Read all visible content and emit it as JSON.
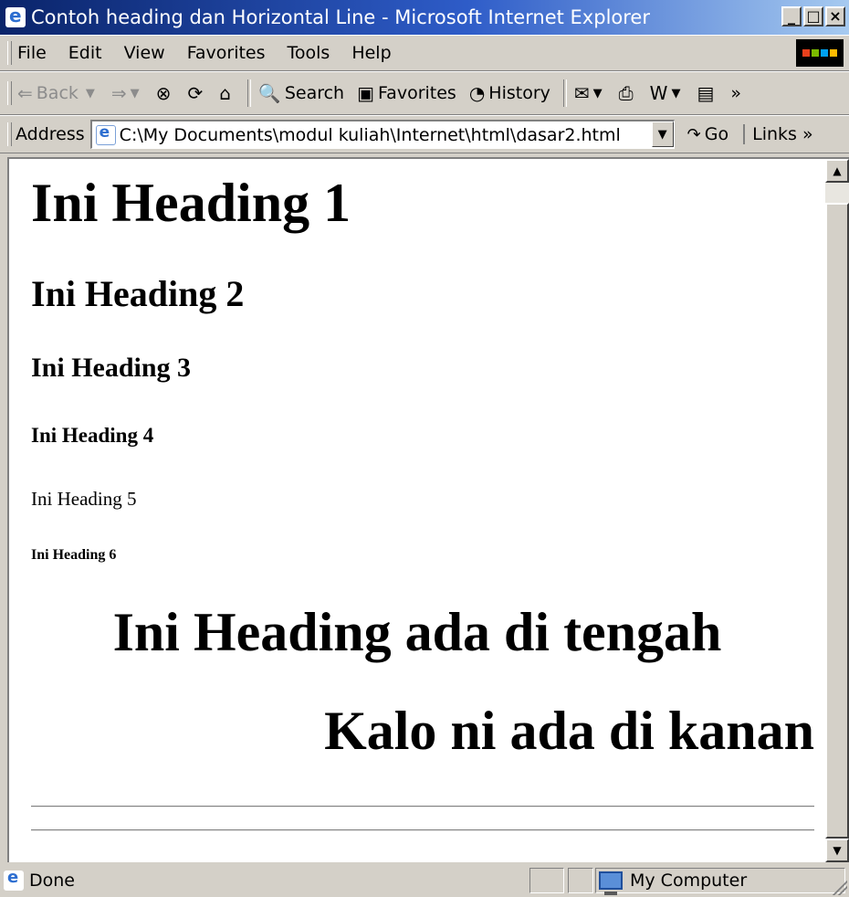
{
  "window": {
    "title": "Contoh heading dan Horizontal Line - Microsoft Internet Explorer",
    "minimize": "_",
    "maximize": "□",
    "close": "×"
  },
  "menu": {
    "items": [
      "File",
      "Edit",
      "View",
      "Favorites",
      "Tools",
      "Help"
    ]
  },
  "toolbar": {
    "back": "Back",
    "search": "Search",
    "favorites": "Favorites",
    "history": "History",
    "more": "»"
  },
  "address": {
    "label": "Address",
    "url": "C:\\My Documents\\modul kuliah\\Internet\\html\\dasar2.html",
    "go": "Go",
    "links": "Links"
  },
  "page": {
    "h1": "Ini Heading 1",
    "h2": "Ini Heading 2",
    "h3": "Ini Heading 3",
    "h4": "Ini Heading 4",
    "h5": "Ini Heading 5",
    "h6": "Ini Heading 6",
    "center_heading": "Ini Heading ada di tengah",
    "right_heading": "Kalo ni ada di kanan"
  },
  "status": {
    "text": "Done",
    "zone": "My Computer"
  }
}
